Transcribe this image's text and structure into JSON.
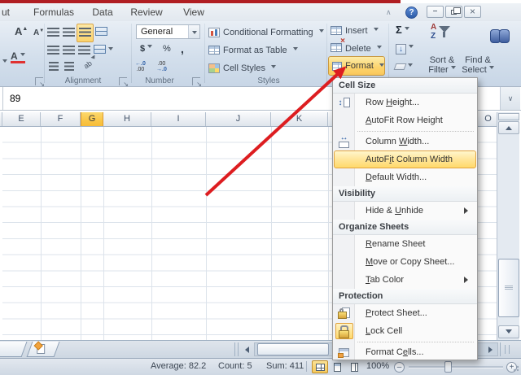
{
  "tabs": {
    "cut": "ut",
    "formulas": "Formulas",
    "data": "Data",
    "review": "Review",
    "view": "View"
  },
  "ribbon": {
    "labels": {
      "alignment": "Alignment",
      "number": "Number",
      "styles": "Styles"
    },
    "number_format": "General",
    "currency": "$",
    "percent": "%",
    "comma": ",",
    "inc_decimal": [
      "←.0",
      ".00"
    ],
    "dec_decimal": [
      ".00",
      "→.0"
    ],
    "styles": {
      "conditional": "Conditional Formatting",
      "format_table": "Format as Table",
      "cell_styles": "Cell Styles"
    },
    "cells": {
      "insert": "Insert",
      "delete": "Delete",
      "format": "Format"
    },
    "editing": {
      "autosum": "Σ",
      "sort1": "Sort &",
      "sort2": "Filter",
      "find1": "Find &",
      "find2": "Select"
    }
  },
  "formula_bar": {
    "value": "89"
  },
  "sheet": {
    "columns": [
      "E",
      "F",
      "G",
      "H",
      "I",
      "J",
      "K",
      "O"
    ],
    "selected_column": "G"
  },
  "menu": {
    "items": [
      {
        "type": "header",
        "label": "Cell Size"
      },
      {
        "type": "item",
        "pre": "Row ",
        "key": "H",
        "post": "eight..."
      },
      {
        "type": "item",
        "pre": "",
        "key": "A",
        "post": "utoFit Row Height"
      },
      {
        "type": "separator"
      },
      {
        "type": "item",
        "pre": "Column ",
        "key": "W",
        "post": "idth..."
      },
      {
        "type": "item",
        "highlighted": true,
        "pre": "AutoF",
        "key": "i",
        "post": "t Column Width"
      },
      {
        "type": "item",
        "pre": "",
        "key": "D",
        "post": "efault Width..."
      },
      {
        "type": "header",
        "label": "Visibility"
      },
      {
        "type": "item",
        "submenu": true,
        "pre": "Hide & ",
        "key": "U",
        "post": "nhide"
      },
      {
        "type": "header",
        "label": "Organize Sheets"
      },
      {
        "type": "item",
        "pre": "",
        "key": "R",
        "post": "ename Sheet"
      },
      {
        "type": "item",
        "pre": "",
        "key": "M",
        "post": "ove or Copy Sheet..."
      },
      {
        "type": "item",
        "submenu": true,
        "pre": "",
        "key": "T",
        "post": "ab Color"
      },
      {
        "type": "header",
        "label": "Protection"
      },
      {
        "type": "item",
        "pre": "",
        "key": "P",
        "post": "rotect Sheet..."
      },
      {
        "type": "item",
        "pre": "",
        "key": "L",
        "post": "ock Cell"
      },
      {
        "type": "separator"
      },
      {
        "type": "item",
        "pre": "Format C",
        "key": "e",
        "post": "lls..."
      }
    ]
  },
  "status_bar": {
    "average": "Average: 82.2",
    "count": "Count: 5",
    "sum": "Sum: 411",
    "zoom": "100%"
  },
  "colors": {
    "accent_highlight": "#FBD36B",
    "highlight_border": "#D9A44A",
    "selected_header": "#F9C648",
    "arrow_red": "#DD1D20"
  }
}
